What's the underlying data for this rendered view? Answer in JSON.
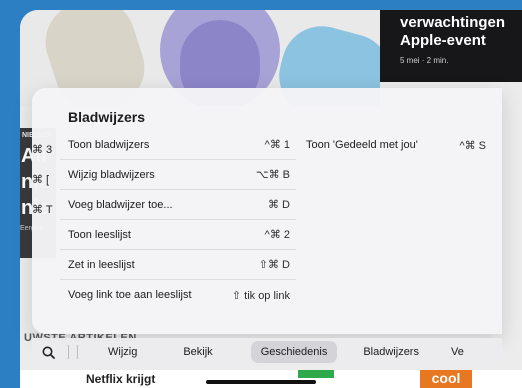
{
  "background": {
    "news_card": {
      "title": "verwachtingen Apple-event",
      "meta": "5 mei · 2 min."
    },
    "side_card": {
      "badge": "NIEUWS",
      "lines": [
        "Air",
        "nie",
        "nie"
      ],
      "small": "Eergistr"
    },
    "section_label": "UWSTE ARTIKELEN",
    "bottom_title": "Netflix krijgt",
    "bottom_badge": "cool"
  },
  "menu": {
    "title": "Bladwijzers",
    "left_peek": [
      "⌘ 3",
      "⌘ [",
      "⌘ T"
    ],
    "left_items": [
      {
        "label": "Toon bladwijzers",
        "shortcut": "^⌘ 1"
      },
      {
        "label": "Wijzig bladwijzers",
        "shortcut": "⌥⌘ B"
      },
      {
        "label": "Voeg bladwijzer toe...",
        "shortcut": "⌘ D"
      },
      {
        "label": "Toon leeslijst",
        "shortcut": "^⌘ 2"
      },
      {
        "label": "Zet in leeslijst",
        "shortcut": "⇧⌘ D"
      },
      {
        "label": "Voeg link toe aan leeslijst",
        "shortcut": "⇧ tik op link"
      }
    ],
    "right_items": [
      {
        "label": "Toon 'Gedeeld met jou'",
        "shortcut": "^⌘ S"
      }
    ]
  },
  "tabbar": {
    "search_icon": "search-icon",
    "tabs": [
      "Wijzig",
      "Bekijk",
      "Geschiedenis",
      "Bladwijzers",
      "Ve"
    ],
    "active_index": 2
  }
}
